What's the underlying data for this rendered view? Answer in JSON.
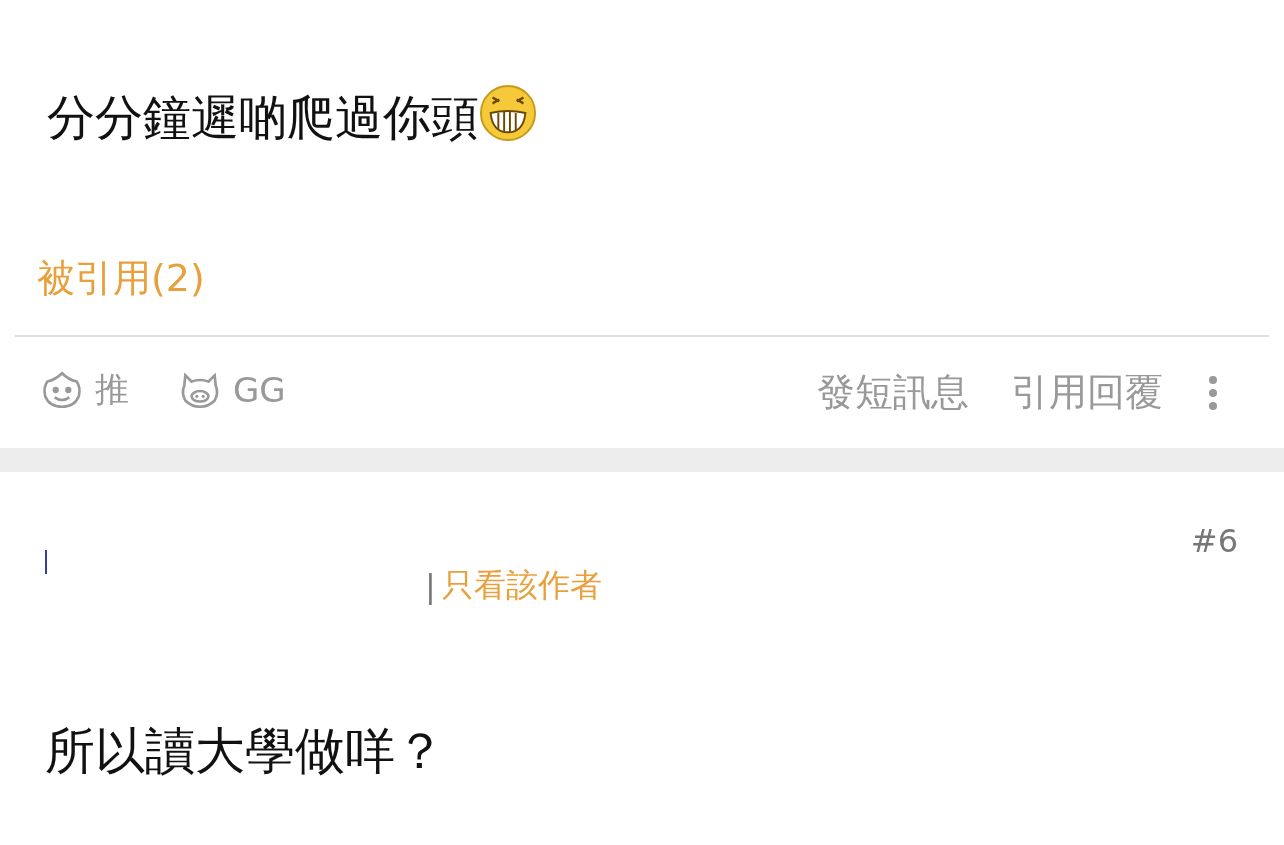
{
  "posts": [
    {
      "content": "分分鐘遲啲爬過你頭",
      "emoticon": true,
      "quoted_by": "被引用(2)",
      "reactions": [
        {
          "kind": "push",
          "label": "推"
        },
        {
          "kind": "gg",
          "label": "GG"
        }
      ],
      "actions": [
        "發短訊息",
        "引用回覆"
      ]
    },
    {
      "floor": "#6",
      "separator": "|",
      "author_filter": "只看該作者",
      "content": "所以讀大學做咩？"
    }
  ]
}
